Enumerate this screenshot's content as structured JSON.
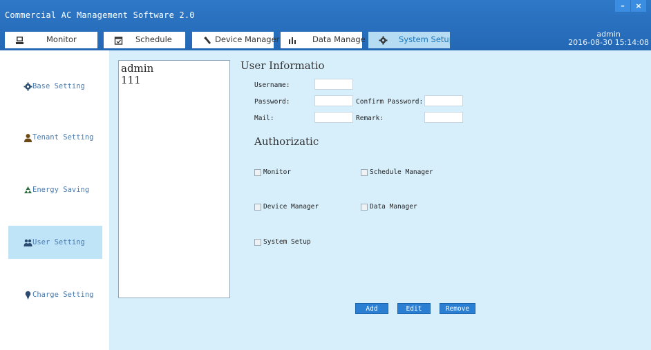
{
  "app": {
    "title": "Commercial AC Management Software 2.0",
    "minimize_glyph": "–",
    "close_glyph": "×",
    "user": "admin",
    "datetime": "2016-08-30 15:14:08"
  },
  "tabs": [
    {
      "label": "Monitor",
      "icon": "monitor-icon"
    },
    {
      "label": "Schedule",
      "icon": "calendar-icon"
    },
    {
      "label": "Device Manager",
      "icon": "wrench-icon"
    },
    {
      "label": "Data Manage",
      "icon": "bar-chart-icon"
    },
    {
      "label": "System Setup",
      "icon": "gear-icon",
      "active": true
    }
  ],
  "sidebar": {
    "items": [
      {
        "label": "Base Setting",
        "icon": "gear-icon"
      },
      {
        "label": "Tenant Setting",
        "icon": "person-icon"
      },
      {
        "label": "Energy Saving",
        "icon": "recycle-icon"
      },
      {
        "label": "User Setting",
        "icon": "users-icon",
        "active": true
      },
      {
        "label": "Charge Setting",
        "icon": "pin-icon"
      }
    ]
  },
  "user_list": [
    "admin",
    "111"
  ],
  "user_info": {
    "title": "User Informatio",
    "username_label": "Username:",
    "password_label": "Password:",
    "confirm_label": "Confirm Password:",
    "mail_label": "Mail:",
    "remark_label": "Remark:",
    "username_value": "",
    "password_value": "",
    "confirm_value": "",
    "mail_value": "",
    "remark_value": ""
  },
  "authorization": {
    "title": "Authorizatic",
    "options": [
      {
        "label": "Monitor",
        "checked": false
      },
      {
        "label": "Schedule Manager",
        "checked": false
      },
      {
        "label": "Device Manager",
        "checked": false
      },
      {
        "label": "Data Manager",
        "checked": false
      },
      {
        "label": "System Setup",
        "checked": false
      }
    ]
  },
  "buttons": {
    "add": "Add",
    "edit": "Edit",
    "remove": "Remove"
  },
  "colors": {
    "titlebar": "#2468b5",
    "accent": "#2b7fd3",
    "content_bg": "#d7eefb",
    "active_tab_bg": "#b5dcf3"
  }
}
